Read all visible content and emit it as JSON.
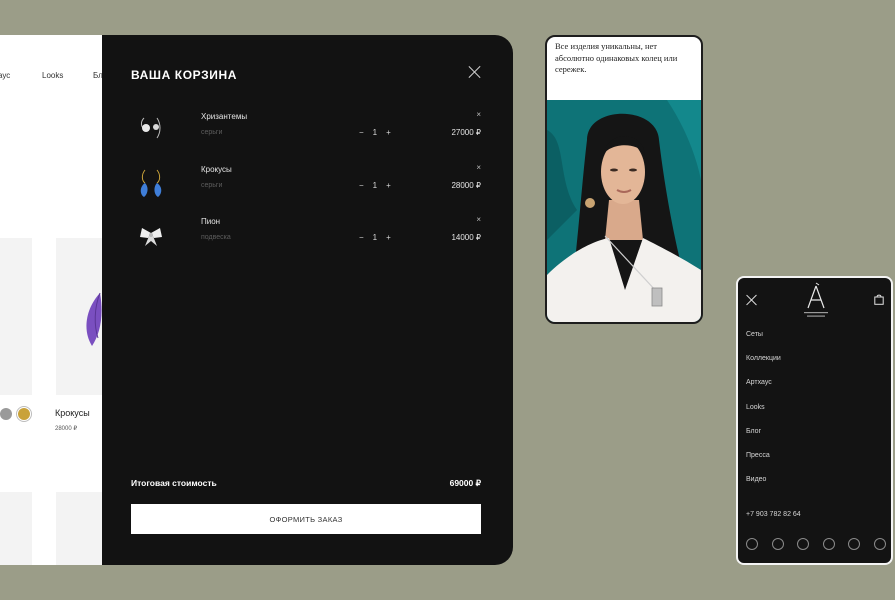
{
  "shop": {
    "nav": [
      "аус",
      "Looks",
      "Бл"
    ],
    "product_name": "Крокусы",
    "product_price": "28000 ₽"
  },
  "cart": {
    "title": "ВАША КОРЗИНА",
    "items": [
      {
        "name": "Хризантемы",
        "type": "серьги",
        "qty": "1",
        "price": "27000 ₽"
      },
      {
        "name": "Крокусы",
        "type": "серьги",
        "qty": "1",
        "price": "28000 ₽"
      },
      {
        "name": "Пион",
        "type": "подвеска",
        "qty": "1",
        "price": "14000 ₽"
      }
    ],
    "remove_symbol": "×",
    "minus_symbol": "−",
    "plus_symbol": "+",
    "total_label": "Итоговая стоимость",
    "total_value": "69000 ₽",
    "checkout_label": "ОФОРМИТЬ ЗАКАЗ"
  },
  "phone1": {
    "text": "Все изделия уникальны, нет абсолютно одинаковых колец или сережек."
  },
  "phone2": {
    "menu": [
      "Сеты",
      "Коллекции",
      "Артхаус",
      "Looks",
      "Блог",
      "Пресса",
      "Видео"
    ],
    "phone": "+7 903 782 82 64",
    "socials": [
      "telegram-icon",
      "whatsapp-icon",
      "instagram-icon",
      "pinterest-icon",
      "vk-icon",
      "tiktok-icon"
    ]
  },
  "colors": {
    "background": "#9b9d88",
    "panel": "#121212",
    "photo_teal": "#0e7377",
    "swatch_grey": "#9a9a9a",
    "swatch_gold": "#c9a23a"
  }
}
